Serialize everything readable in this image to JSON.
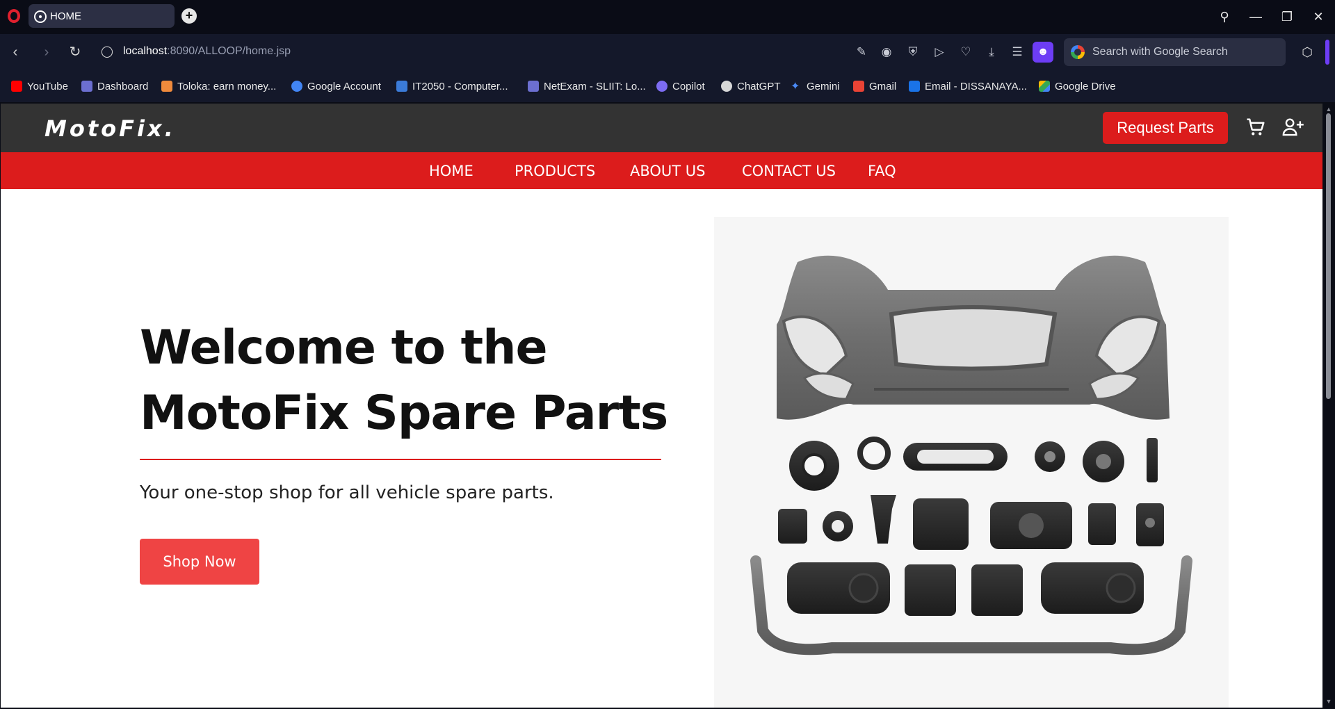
{
  "browser": {
    "tab_title": "HOME",
    "url_host": "localhost",
    "url_rest": ":8090/ALLOOP/home.jsp",
    "search_placeholder": "Search with Google Search",
    "bookmarks": [
      {
        "label": "YouTube",
        "color": "#ff0000"
      },
      {
        "label": "Dashboard",
        "color": "#6c6fd0"
      },
      {
        "label": "Toloka: earn money...",
        "color": "#f08a3c"
      },
      {
        "label": "Google Account",
        "color": "#4285f4"
      },
      {
        "label": "IT2050 - Computer...",
        "color": "#3b7bd8"
      },
      {
        "label": "NetExam - SLIIT: Lo...",
        "color": "#6c6fd0"
      },
      {
        "label": "Copilot",
        "color": "#7d6cf2"
      },
      {
        "label": "ChatGPT",
        "color": "#d8d8d8"
      },
      {
        "label": "Gemini",
        "color": "#4b8af6"
      },
      {
        "label": "Gmail",
        "color": "#ea4335"
      },
      {
        "label": "Email - DISSANAYA...",
        "color": "#1a73e8"
      },
      {
        "label": "Google Drive",
        "color": "#34a853"
      }
    ]
  },
  "site": {
    "brand": "MotoFix.",
    "request_button": "Request Parts",
    "nav": [
      "HOME",
      "PRODUCTS",
      "ABOUT US",
      "CONTACT US",
      "FAQ"
    ],
    "hero": {
      "title_line1": "Welcome to the",
      "title_line2": "MotoFix Spare Parts",
      "subtitle": "Your one-stop shop for all vehicle spare parts.",
      "cta": "Shop Now"
    }
  },
  "colors": {
    "accent_red": "#dc1c1c",
    "header_dark": "#333333",
    "cta_red": "#ef4444",
    "browser_purple": "#6d3df5"
  }
}
